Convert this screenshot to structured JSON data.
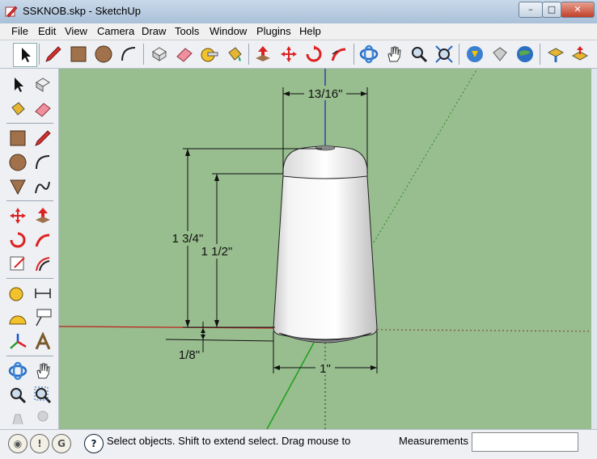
{
  "window": {
    "title": "SSKNOB.skp - SketchUp",
    "controls": [
      "minimize",
      "maximize",
      "close"
    ]
  },
  "menu": {
    "items": [
      "File",
      "Edit",
      "View",
      "Camera",
      "Draw",
      "Tools",
      "Window",
      "Plugins",
      "Help"
    ]
  },
  "toolbar_top": {
    "icons": [
      "select-icon",
      "pencil-line-icon",
      "rectangle-icon",
      "circle-icon",
      "arc-icon",
      "make-component-icon",
      "eraser-icon",
      "tape-measure-icon",
      "paint-bucket-icon",
      "push-pull-icon",
      "move-icon",
      "rotate-icon",
      "follow-me-icon",
      "orbit-icon",
      "pan-hand-icon",
      "zoom-icon",
      "zoom-extents-icon",
      "get-models-icon",
      "share-model-icon",
      "google-earth-icon",
      "get-current-view-icon",
      "place-model-icon"
    ]
  },
  "toolbar_left": {
    "icons": [
      "select-icon",
      "make-component-icon",
      "paint-bucket-icon",
      "eraser-icon",
      "rectangle-icon",
      "pencil-line-icon",
      "circle-icon",
      "arc-icon",
      "polygon-icon",
      "freehand-icon",
      "move-icon",
      "push-pull-icon",
      "rotate-icon",
      "follow-me-icon",
      "scale-icon",
      "offset-icon",
      "tape-measure-icon",
      "dimension-icon",
      "protractor-icon",
      "text-icon",
      "axes-icon",
      "3d-text-icon",
      "orbit-icon",
      "pan-hand-icon",
      "zoom-icon",
      "zoom-window-icon",
      "walk-icon",
      "look-around-icon"
    ]
  },
  "viewport": {
    "background_color": "#98bd8e",
    "dimensions": {
      "width": "13/16\"",
      "height_total": "1 3/4\"",
      "height_body": "1 1/2\"",
      "base": "1/8\"",
      "bottom_width": "1\""
    }
  },
  "status": {
    "icons": [
      "geo-location-icon",
      "credits-icon",
      "user-icon"
    ],
    "help_icon": "help-icon",
    "text": "Select objects. Shift to extend select. Drag mouse to",
    "measurements_label": "Measurements",
    "measurements_value": ""
  }
}
